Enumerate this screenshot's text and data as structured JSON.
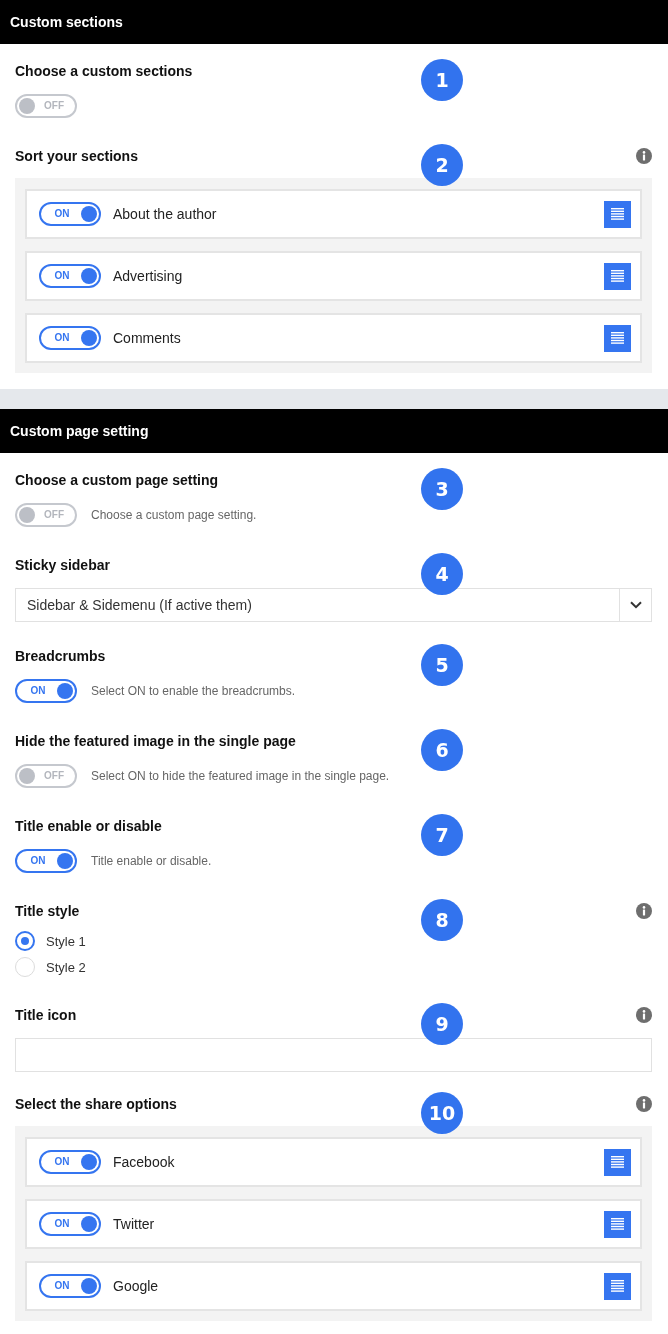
{
  "sections": [
    {
      "title": "Custom sections",
      "fields": [
        {
          "kind": "toggle",
          "label": "Choose a custom sections",
          "badge": "1",
          "toggle": {
            "on": false,
            "text": "OFF"
          }
        },
        {
          "kind": "sortable",
          "label": "Sort your sections",
          "badge": "2",
          "info": true,
          "items": [
            {
              "label": "About the author",
              "toggle": {
                "on": true,
                "text": "ON"
              }
            },
            {
              "label": "Advertising",
              "toggle": {
                "on": true,
                "text": "ON"
              }
            },
            {
              "label": "Comments",
              "toggle": {
                "on": true,
                "text": "ON"
              }
            }
          ]
        }
      ]
    },
    {
      "title": "Custom page setting",
      "fields": [
        {
          "kind": "toggle",
          "label": "Choose a custom page setting",
          "badge": "3",
          "toggle": {
            "on": false,
            "text": "OFF"
          },
          "description": "Choose a custom page setting."
        },
        {
          "kind": "select",
          "label": "Sticky sidebar",
          "badge": "4",
          "value": "Sidebar & Sidemenu (If active them)"
        },
        {
          "kind": "toggle",
          "label": "Breadcrumbs",
          "badge": "5",
          "toggle": {
            "on": true,
            "text": "ON"
          },
          "description": "Select ON to enable the breadcrumbs."
        },
        {
          "kind": "toggle",
          "label": "Hide the featured image in the single page",
          "badge": "6",
          "toggle": {
            "on": false,
            "text": "OFF"
          },
          "description": "Select ON to hide the featured image in the single page."
        },
        {
          "kind": "toggle",
          "label": "Title enable or disable",
          "badge": "7",
          "toggle": {
            "on": true,
            "text": "ON"
          },
          "description": "Title enable or disable."
        },
        {
          "kind": "radio",
          "label": "Title style",
          "badge": "8",
          "info": true,
          "options": [
            {
              "label": "Style 1",
              "selected": true
            },
            {
              "label": "Style 2",
              "selected": false
            }
          ]
        },
        {
          "kind": "text",
          "label": "Title icon",
          "badge": "9",
          "info": true
        },
        {
          "kind": "sortable",
          "label": "Select the share options",
          "badge": "10",
          "info": true,
          "items": [
            {
              "label": "Facebook",
              "toggle": {
                "on": true,
                "text": "ON"
              }
            },
            {
              "label": "Twitter",
              "toggle": {
                "on": true,
                "text": "ON"
              }
            },
            {
              "label": "Google",
              "toggle": {
                "on": true,
                "text": "ON"
              }
            }
          ]
        }
      ]
    }
  ]
}
